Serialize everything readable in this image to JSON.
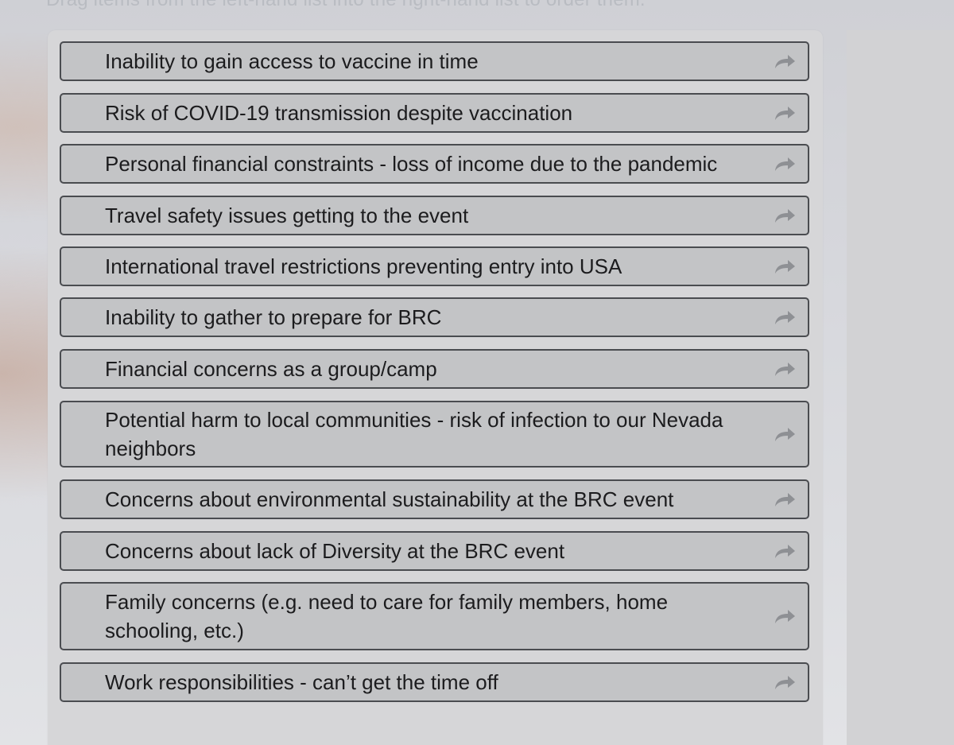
{
  "instruction": "Drag items from the left-hand list into the right-hand list to order them.",
  "items": [
    {
      "label": "Inability to gain access to vaccine in time",
      "icon": "forward-arrow-icon"
    },
    {
      "label": "Risk of COVID-19 transmission despite vaccination",
      "icon": "forward-arrow-icon"
    },
    {
      "label": "Personal financial constraints - loss of income due to the pandemic",
      "icon": "forward-arrow-icon"
    },
    {
      "label": "Travel safety issues getting to the event",
      "icon": "forward-arrow-icon"
    },
    {
      "label": "International travel restrictions preventing entry into USA",
      "icon": "forward-arrow-icon"
    },
    {
      "label": "Inability to gather to prepare for BRC",
      "icon": "forward-arrow-icon"
    },
    {
      "label": "Financial concerns as a group/camp",
      "icon": "forward-arrow-icon"
    },
    {
      "label": "Potential harm to local communities - risk of infection to our Nevada neighbors",
      "icon": "forward-arrow-icon"
    },
    {
      "label": "Concerns about environmental sustainability at the BRC event",
      "icon": "forward-arrow-icon"
    },
    {
      "label": "Concerns about lack of Diversity at the BRC event",
      "icon": "forward-arrow-icon"
    },
    {
      "label": "Family concerns (e.g. need to care for family members, home schooling, etc.)",
      "icon": "forward-arrow-icon"
    },
    {
      "label": "Work responsibilities - can’t get the time off",
      "icon": "forward-arrow-icon"
    }
  ],
  "colors": {
    "item_background": "#c3c4c6",
    "item_border": "#4a4c50",
    "icon_color": "#8e9094",
    "text_color": "#1c1c1e"
  }
}
